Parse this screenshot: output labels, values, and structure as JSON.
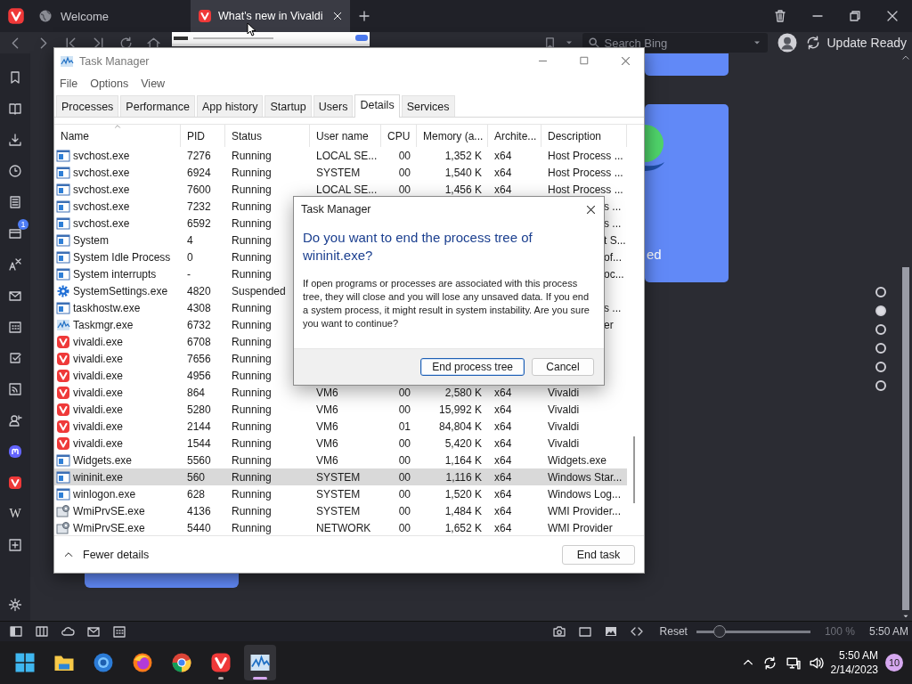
{
  "browser": {
    "tabs": [
      {
        "title": "Welcome",
        "kind": "globe",
        "selected": false
      },
      {
        "title": "What's new in Vivaldi",
        "kind": "vivaldi",
        "selected": true
      }
    ],
    "search": {
      "placeholder": "Search Bing"
    },
    "update_label": "Update Ready",
    "panel_items": [
      {
        "kind": "bookmark"
      },
      {
        "kind": "reader"
      },
      {
        "kind": "download"
      },
      {
        "kind": "clock"
      },
      {
        "kind": "notes"
      },
      {
        "kind": "window",
        "badge": "1"
      },
      {
        "kind": "translate"
      },
      {
        "kind": "mail"
      },
      {
        "kind": "calendar"
      },
      {
        "kind": "task"
      },
      {
        "kind": "feed"
      },
      {
        "kind": "contacts"
      },
      {
        "kind": "mastodon"
      },
      {
        "kind": "vivaldi"
      },
      {
        "kind": "wiki",
        "label": "W"
      },
      {
        "kind": "add"
      }
    ],
    "page": {
      "card_text": "ed",
      "dots": [
        {
          "selected": false
        },
        {
          "selected": true
        },
        {
          "selected": false
        },
        {
          "selected": false
        },
        {
          "selected": false
        },
        {
          "selected": false
        }
      ]
    },
    "status_bar": {
      "reset": "Reset",
      "zoom": {
        "level": 0.2
      },
      "zoom_reading": "100 %",
      "clock": "5:50 AM"
    }
  },
  "task_manager": {
    "title": "Task Manager",
    "menu": [
      "File",
      "Options",
      "View"
    ],
    "tabs": [
      {
        "label": "Processes",
        "selected": false
      },
      {
        "label": "Performance",
        "selected": false
      },
      {
        "label": "App history",
        "selected": false
      },
      {
        "label": "Startup",
        "selected": false
      },
      {
        "label": "Users",
        "selected": false
      },
      {
        "label": "Details",
        "selected": true
      },
      {
        "label": "Services",
        "selected": false
      }
    ],
    "columns": [
      {
        "label": "Name",
        "sorted": true
      },
      {
        "label": "PID",
        "sorted": false
      },
      {
        "label": "Status",
        "sorted": false
      },
      {
        "label": "User name",
        "sorted": false
      },
      {
        "label": "CPU",
        "sorted": false
      },
      {
        "label": "Memory (a...",
        "sorted": false
      },
      {
        "label": "Archite...",
        "sorted": false
      },
      {
        "label": "Description",
        "sorted": false
      }
    ],
    "rows": [
      {
        "kind": "service",
        "name": "svchost.exe",
        "pid": "7276",
        "status": "Running",
        "user": "LOCAL SE...",
        "cpu": "00",
        "memory": "1,352 K",
        "arch": "x64",
        "description": "Host Process ...",
        "selected": false
      },
      {
        "kind": "service",
        "name": "svchost.exe",
        "pid": "6924",
        "status": "Running",
        "user": "SYSTEM",
        "cpu": "00",
        "memory": "1,540 K",
        "arch": "x64",
        "description": "Host Process ...",
        "selected": false
      },
      {
        "kind": "service",
        "name": "svchost.exe",
        "pid": "7600",
        "status": "Running",
        "user": "LOCAL SE...",
        "cpu": "00",
        "memory": "1,456 K",
        "arch": "x64",
        "description": "Host Process ...",
        "selected": false
      },
      {
        "kind": "service",
        "name": "svchost.exe",
        "pid": "7232",
        "status": "Running",
        "description": "s ...",
        "selected": false
      },
      {
        "kind": "service",
        "name": "svchost.exe",
        "pid": "6592",
        "status": "Running",
        "description": "s ...",
        "selected": false
      },
      {
        "kind": "service",
        "name": "System",
        "pid": "4",
        "status": "Running",
        "description": "t S...",
        "selected": false
      },
      {
        "kind": "service",
        "name": "System Idle Process",
        "pid": "0",
        "status": "Running",
        "description": "of...",
        "selected": false
      },
      {
        "kind": "service",
        "name": "System interrupts",
        "pid": "-",
        "status": "Running",
        "description": "oc...",
        "selected": false
      },
      {
        "kind": "settings",
        "name": "SystemSettings.exe",
        "pid": "4820",
        "status": "Suspended",
        "selected": false
      },
      {
        "kind": "service",
        "name": "taskhostw.exe",
        "pid": "4308",
        "status": "Running",
        "description": "s ...",
        "selected": false
      },
      {
        "kind": "chart",
        "name": "Taskmgr.exe",
        "pid": "6732",
        "status": "Running",
        "description": "er",
        "selected": false
      },
      {
        "kind": "vivaldi",
        "name": "vivaldi.exe",
        "pid": "6708",
        "status": "Running",
        "selected": false
      },
      {
        "kind": "vivaldi",
        "name": "vivaldi.exe",
        "pid": "7656",
        "status": "Running",
        "selected": false
      },
      {
        "kind": "vivaldi",
        "name": "vivaldi.exe",
        "pid": "4956",
        "status": "Running",
        "selected": false
      },
      {
        "kind": "vivaldi",
        "name": "vivaldi.exe",
        "pid": "864",
        "status": "Running",
        "user": "VM6",
        "cpu": "00",
        "memory": "2,580 K",
        "arch": "x64",
        "description": "Vivaldi",
        "selected": false
      },
      {
        "kind": "vivaldi",
        "name": "vivaldi.exe",
        "pid": "5280",
        "status": "Running",
        "user": "VM6",
        "cpu": "00",
        "memory": "15,992 K",
        "arch": "x64",
        "description": "Vivaldi",
        "selected": false
      },
      {
        "kind": "vivaldi",
        "name": "vivaldi.exe",
        "pid": "2144",
        "status": "Running",
        "user": "VM6",
        "cpu": "01",
        "memory": "84,804 K",
        "arch": "x64",
        "description": "Vivaldi",
        "selected": false
      },
      {
        "kind": "vivaldi",
        "name": "vivaldi.exe",
        "pid": "1544",
        "status": "Running",
        "user": "VM6",
        "cpu": "00",
        "memory": "5,420 K",
        "arch": "x64",
        "description": "Vivaldi",
        "selected": false
      },
      {
        "kind": "service",
        "name": "Widgets.exe",
        "pid": "5560",
        "status": "Running",
        "user": "VM6",
        "cpu": "00",
        "memory": "1,164 K",
        "arch": "x64",
        "description": "Widgets.exe",
        "selected": false
      },
      {
        "kind": "service",
        "name": "wininit.exe",
        "pid": "560",
        "status": "Running",
        "user": "SYSTEM",
        "cpu": "00",
        "memory": "1,116 K",
        "arch": "x64",
        "description": "Windows Star...",
        "selected": true
      },
      {
        "kind": "service",
        "name": "winlogon.exe",
        "pid": "628",
        "status": "Running",
        "user": "SYSTEM",
        "cpu": "00",
        "memory": "1,520 K",
        "arch": "x64",
        "description": "Windows Log...",
        "selected": false
      },
      {
        "kind": "wmi",
        "name": "WmiPrvSE.exe",
        "pid": "4136",
        "status": "Running",
        "user": "SYSTEM",
        "cpu": "00",
        "memory": "1,484 K",
        "arch": "x64",
        "description": "WMI Provider...",
        "selected": false
      },
      {
        "kind": "wmi",
        "name": "WmiPrvSE.exe",
        "pid": "5440",
        "status": "Running",
        "user": "NETWORK",
        "cpu": "00",
        "memory": "1,652 K",
        "arch": "x64",
        "description": "WMI Provider",
        "selected": false
      }
    ],
    "fewer_details": "Fewer details",
    "end_task": "End task"
  },
  "dialog": {
    "title": "Task Manager",
    "heading": "Do you want to end the process tree of wininit.exe?",
    "message": "If open programs or processes are associated with this process tree, they will close and you will lose any unsaved data. If you end a system process, it might result in system instability. Are you sure you want to continue?",
    "buttons": [
      {
        "label": "End process tree",
        "default": true
      },
      {
        "label": "Cancel",
        "default": false
      }
    ]
  },
  "taskbar": {
    "apps": [
      {
        "kind": "start",
        "selected": false,
        "running": false
      },
      {
        "kind": "folder",
        "selected": false,
        "running": false
      },
      {
        "kind": "bluebrowser",
        "selected": false,
        "running": false
      },
      {
        "kind": "fox",
        "selected": false,
        "running": false
      },
      {
        "kind": "chrome",
        "selected": false,
        "running": false
      },
      {
        "kind": "vivaldi",
        "selected": false,
        "running": true
      },
      {
        "kind": "chart",
        "selected": true,
        "running": true
      }
    ],
    "time": "5:50 AM",
    "date": "2/14/2023",
    "notifications": "10"
  }
}
